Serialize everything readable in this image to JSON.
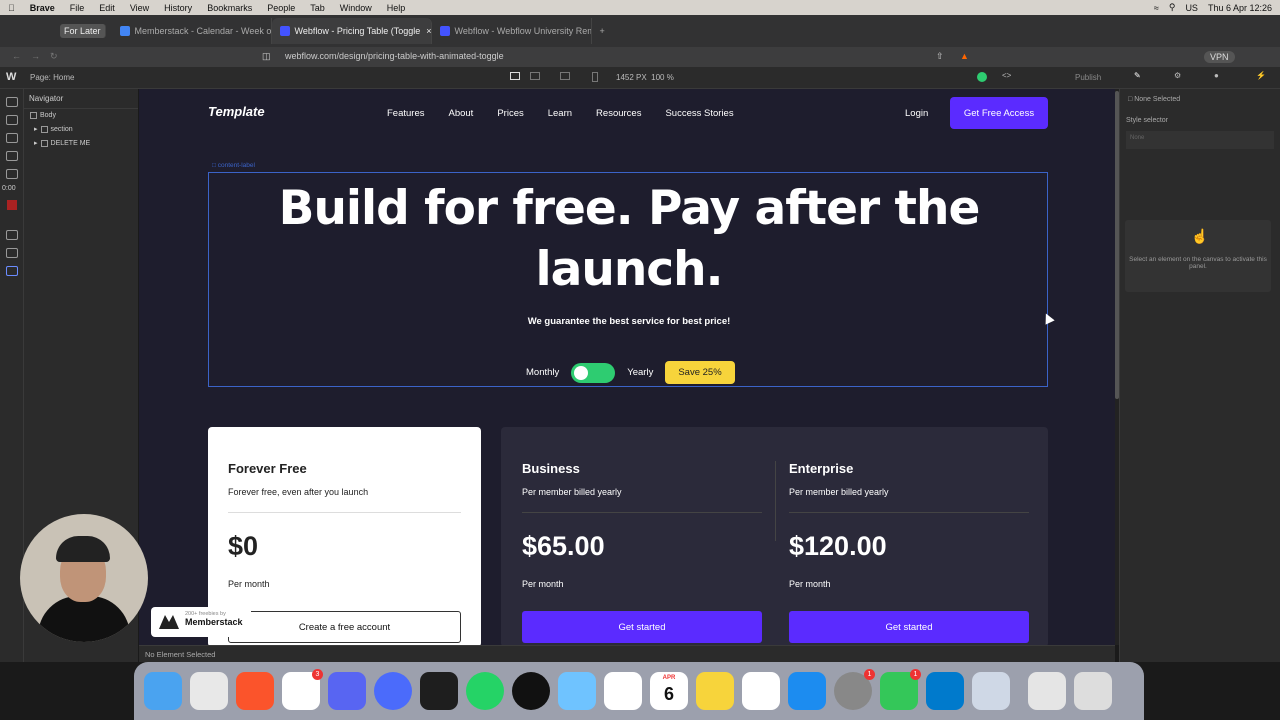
{
  "menubar": {
    "app": "Brave",
    "items": [
      "File",
      "Edit",
      "View",
      "History",
      "Bookmarks",
      "People",
      "Tab",
      "Window",
      "Help"
    ],
    "lang": "US",
    "clock": "Thu 6 Apr 12:26"
  },
  "tabs": [
    {
      "label": "For Later"
    },
    {
      "label": "Memberstack - Calendar - Week of"
    },
    {
      "label": "Webflow - Pricing Table (Toggle"
    },
    {
      "label": "Webflow - Webflow University Rem"
    }
  ],
  "address": {
    "url": "webflow.com/design/pricing-table-with-animated-toggle",
    "vpn": "VPN"
  },
  "webflow_bar": {
    "logo": "W",
    "page": "Page: Home",
    "width": "1452 PX",
    "zoom": "100 %",
    "publish": "Publish"
  },
  "navigator": {
    "title": "Navigator",
    "rows": [
      "Body",
      "section",
      "DELETE ME"
    ],
    "timer": "0:00"
  },
  "right_panel": {
    "none_selected": "None Selected",
    "style_selector": "Style selector",
    "style_placeholder": "None",
    "hint": "Select an element on the canvas to activate this panel."
  },
  "site": {
    "logo": "Template",
    "nav": [
      "Features",
      "About",
      "Prices",
      "Learn",
      "Resources",
      "Success Stories"
    ],
    "login": "Login",
    "cta": "Get Free Access",
    "content_label": "content-label",
    "headline": "Build for free. Pay after the launch.",
    "subheadline": "We guarantee the best service for best price!",
    "toggle": {
      "monthly": "Monthly",
      "yearly": "Yearly",
      "save": "Save 25%"
    },
    "plans": [
      {
        "name": "Forever Free",
        "desc": "Forever free, even after you launch",
        "price": "$0",
        "per": "Per month",
        "button": "Create a free account"
      },
      {
        "name": "Business",
        "desc": "Per member billed yearly",
        "price": "$65.00",
        "per": "Per month",
        "button": "Get started"
      },
      {
        "name": "Enterprise",
        "desc": "Per member billed yearly",
        "price": "$120.00",
        "per": "Per month",
        "button": "Get started"
      }
    ]
  },
  "status": {
    "text": "No Element Selected"
  },
  "memberstack_badge": {
    "small": "200+ freebies by",
    "big": "Memberstack"
  },
  "dock": {
    "calendar_month": "APR",
    "calendar_day": "6",
    "badges": {
      "slack": "3",
      "settings": "1",
      "messages": "1"
    },
    "apps": [
      "finder-icon",
      "launchpad-icon",
      "brave-icon",
      "slack-icon",
      "discord-icon",
      "perplexity-icon",
      "figma-icon",
      "whatsapp-icon",
      "spotify-icon",
      "maps-icon",
      "reminders-icon",
      "calendar-icon",
      "notes-icon",
      "freeform-icon",
      "appstore-icon",
      "settings-icon",
      "messages-icon",
      "vscode-icon",
      "preview-icon",
      "downloads-icon",
      "trash-icon"
    ]
  }
}
